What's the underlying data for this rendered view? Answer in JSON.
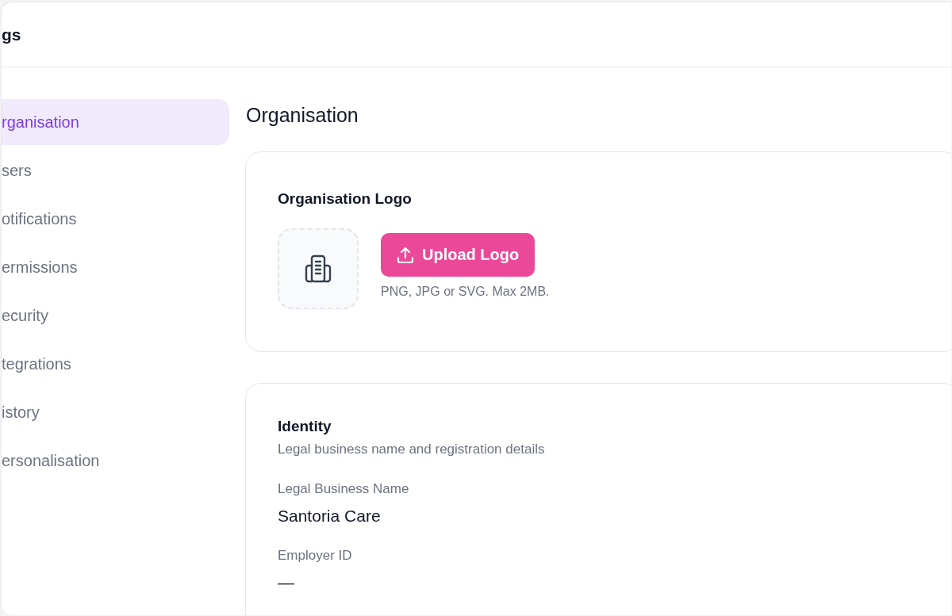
{
  "header": {
    "title": "gs"
  },
  "sidebar": {
    "items": [
      {
        "label": "rganisation",
        "selected": true
      },
      {
        "label": "sers",
        "selected": false
      },
      {
        "label": "otifications",
        "selected": false
      },
      {
        "label": "ermissions",
        "selected": false
      },
      {
        "label": "ecurity",
        "selected": false
      },
      {
        "label": "tegrations",
        "selected": false
      },
      {
        "label": "istory",
        "selected": false
      },
      {
        "label": "ersonalisation",
        "selected": false
      }
    ]
  },
  "main": {
    "title": "Organisation",
    "logo_card": {
      "title": "Organisation Logo",
      "upload_button": "Upload Logo",
      "hint": "PNG, JPG or SVG. Max 2MB."
    },
    "identity_card": {
      "title": "Identity",
      "subtitle": "Legal business name and registration details",
      "fields": [
        {
          "label": "Legal Business Name",
          "value": "Santoria Care"
        },
        {
          "label": "Employer ID",
          "value": "—"
        }
      ]
    }
  }
}
